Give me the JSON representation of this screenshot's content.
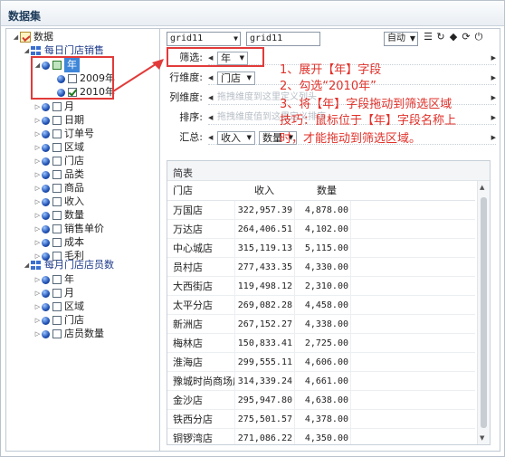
{
  "window": {
    "title": "数据集"
  },
  "tree": {
    "root": "数据",
    "group1": {
      "label": "每日门店销售"
    },
    "year": {
      "label": "年"
    },
    "year_children": [
      "2009年",
      "2010年"
    ],
    "items1": [
      "月",
      "日期",
      "订单号",
      "区域",
      "门店",
      "品类",
      "商品",
      "收入",
      "数量",
      "销售单价",
      "成本",
      "毛利"
    ],
    "group2": {
      "label": "每月门店店员数"
    },
    "items2": [
      "年",
      "月",
      "区域",
      "门店",
      "店员数量"
    ]
  },
  "toolbar": {
    "combo1": "grid11",
    "combo2": "grid11",
    "auto": "自动"
  },
  "dims": {
    "filter_label": "筛选:",
    "filter_chip": "年",
    "row_label": "行维度:",
    "row_chip": "门店",
    "col_label": "列维度:",
    "col_placeholder": "拖拽维度到这里定义列头",
    "sort_label": "排序:",
    "sort_placeholder": "拖拽维度值到这里定义排序",
    "agg_label": "汇总:",
    "agg_chip1": "收入",
    "agg_chip2": "数量"
  },
  "annotations": {
    "step1": "1、展开【年】字段",
    "step2": "2、勾选“2010年”",
    "step3": "3、将【年】字段拖动到筛选区域",
    "tip1": "技巧：鼠标位于【年】字段名称上",
    "tip2": "时，才能拖动到筛选区域。"
  },
  "table": {
    "title": "简表",
    "headers": [
      "门店",
      "收入",
      "数量"
    ],
    "rows": [
      [
        "万国店",
        "322,957.39",
        "4,878.00"
      ],
      [
        "万达店",
        "264,406.51",
        "4,102.00"
      ],
      [
        "中心城店",
        "315,119.13",
        "5,115.00"
      ],
      [
        "员村店",
        "277,433.35",
        "4,330.00"
      ],
      [
        "大西街店",
        "119,498.12",
        "2,310.00"
      ],
      [
        "太平分店",
        "269,082.28",
        "4,458.00"
      ],
      [
        "新洲店",
        "267,152.27",
        "4,338.00"
      ],
      [
        "梅林店",
        "150,833.41",
        "2,725.00"
      ],
      [
        "淮海店",
        "299,555.11",
        "4,606.00"
      ],
      [
        "豫城时尚商场店",
        "314,339.24",
        "4,661.00"
      ],
      [
        "金沙店",
        "295,947.80",
        "4,638.00"
      ],
      [
        "铁西分店",
        "275,501.57",
        "4,378.00"
      ],
      [
        "铜锣湾店",
        "271,086.22",
        "4,350.00"
      ]
    ]
  }
}
